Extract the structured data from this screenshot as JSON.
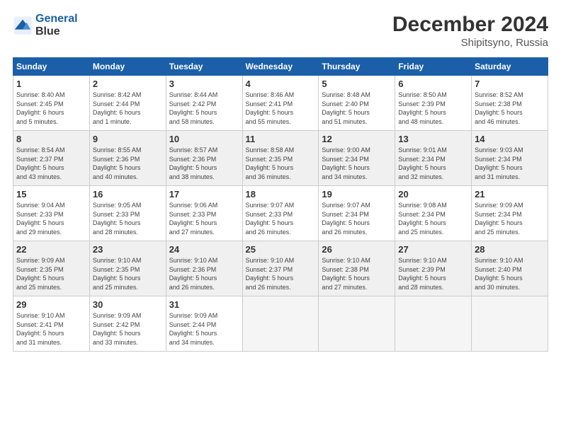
{
  "header": {
    "logo_line1": "General",
    "logo_line2": "Blue",
    "month": "December 2024",
    "location": "Shipitsyno, Russia"
  },
  "days_of_week": [
    "Sunday",
    "Monday",
    "Tuesday",
    "Wednesday",
    "Thursday",
    "Friday",
    "Saturday"
  ],
  "weeks": [
    [
      {
        "num": "1",
        "info": "Sunrise: 8:40 AM\nSunset: 2:45 PM\nDaylight: 6 hours\nand 5 minutes."
      },
      {
        "num": "2",
        "info": "Sunrise: 8:42 AM\nSunset: 2:44 PM\nDaylight: 6 hours\nand 1 minute."
      },
      {
        "num": "3",
        "info": "Sunrise: 8:44 AM\nSunset: 2:42 PM\nDaylight: 5 hours\nand 58 minutes."
      },
      {
        "num": "4",
        "info": "Sunrise: 8:46 AM\nSunset: 2:41 PM\nDaylight: 5 hours\nand 55 minutes."
      },
      {
        "num": "5",
        "info": "Sunrise: 8:48 AM\nSunset: 2:40 PM\nDaylight: 5 hours\nand 51 minutes."
      },
      {
        "num": "6",
        "info": "Sunrise: 8:50 AM\nSunset: 2:39 PM\nDaylight: 5 hours\nand 48 minutes."
      },
      {
        "num": "7",
        "info": "Sunrise: 8:52 AM\nSunset: 2:38 PM\nDaylight: 5 hours\nand 46 minutes."
      }
    ],
    [
      {
        "num": "8",
        "info": "Sunrise: 8:54 AM\nSunset: 2:37 PM\nDaylight: 5 hours\nand 43 minutes."
      },
      {
        "num": "9",
        "info": "Sunrise: 8:55 AM\nSunset: 2:36 PM\nDaylight: 5 hours\nand 40 minutes."
      },
      {
        "num": "10",
        "info": "Sunrise: 8:57 AM\nSunset: 2:36 PM\nDaylight: 5 hours\nand 38 minutes."
      },
      {
        "num": "11",
        "info": "Sunrise: 8:58 AM\nSunset: 2:35 PM\nDaylight: 5 hours\nand 36 minutes."
      },
      {
        "num": "12",
        "info": "Sunrise: 9:00 AM\nSunset: 2:34 PM\nDaylight: 5 hours\nand 34 minutes."
      },
      {
        "num": "13",
        "info": "Sunrise: 9:01 AM\nSunset: 2:34 PM\nDaylight: 5 hours\nand 32 minutes."
      },
      {
        "num": "14",
        "info": "Sunrise: 9:03 AM\nSunset: 2:34 PM\nDaylight: 5 hours\nand 31 minutes."
      }
    ],
    [
      {
        "num": "15",
        "info": "Sunrise: 9:04 AM\nSunset: 2:33 PM\nDaylight: 5 hours\nand 29 minutes."
      },
      {
        "num": "16",
        "info": "Sunrise: 9:05 AM\nSunset: 2:33 PM\nDaylight: 5 hours\nand 28 minutes."
      },
      {
        "num": "17",
        "info": "Sunrise: 9:06 AM\nSunset: 2:33 PM\nDaylight: 5 hours\nand 27 minutes."
      },
      {
        "num": "18",
        "info": "Sunrise: 9:07 AM\nSunset: 2:33 PM\nDaylight: 5 hours\nand 26 minutes."
      },
      {
        "num": "19",
        "info": "Sunrise: 9:07 AM\nSunset: 2:34 PM\nDaylight: 5 hours\nand 26 minutes."
      },
      {
        "num": "20",
        "info": "Sunrise: 9:08 AM\nSunset: 2:34 PM\nDaylight: 5 hours\nand 25 minutes."
      },
      {
        "num": "21",
        "info": "Sunrise: 9:09 AM\nSunset: 2:34 PM\nDaylight: 5 hours\nand 25 minutes."
      }
    ],
    [
      {
        "num": "22",
        "info": "Sunrise: 9:09 AM\nSunset: 2:35 PM\nDaylight: 5 hours\nand 25 minutes."
      },
      {
        "num": "23",
        "info": "Sunrise: 9:10 AM\nSunset: 2:35 PM\nDaylight: 5 hours\nand 25 minutes."
      },
      {
        "num": "24",
        "info": "Sunrise: 9:10 AM\nSunset: 2:36 PM\nDaylight: 5 hours\nand 26 minutes."
      },
      {
        "num": "25",
        "info": "Sunrise: 9:10 AM\nSunset: 2:37 PM\nDaylight: 5 hours\nand 26 minutes."
      },
      {
        "num": "26",
        "info": "Sunrise: 9:10 AM\nSunset: 2:38 PM\nDaylight: 5 hours\nand 27 minutes."
      },
      {
        "num": "27",
        "info": "Sunrise: 9:10 AM\nSunset: 2:39 PM\nDaylight: 5 hours\nand 28 minutes."
      },
      {
        "num": "28",
        "info": "Sunrise: 9:10 AM\nSunset: 2:40 PM\nDaylight: 5 hours\nand 30 minutes."
      }
    ],
    [
      {
        "num": "29",
        "info": "Sunrise: 9:10 AM\nSunset: 2:41 PM\nDaylight: 5 hours\nand 31 minutes."
      },
      {
        "num": "30",
        "info": "Sunrise: 9:09 AM\nSunset: 2:42 PM\nDaylight: 5 hours\nand 33 minutes."
      },
      {
        "num": "31",
        "info": "Sunrise: 9:09 AM\nSunset: 2:44 PM\nDaylight: 5 hours\nand 34 minutes."
      },
      {
        "num": "",
        "info": ""
      },
      {
        "num": "",
        "info": ""
      },
      {
        "num": "",
        "info": ""
      },
      {
        "num": "",
        "info": ""
      }
    ]
  ]
}
